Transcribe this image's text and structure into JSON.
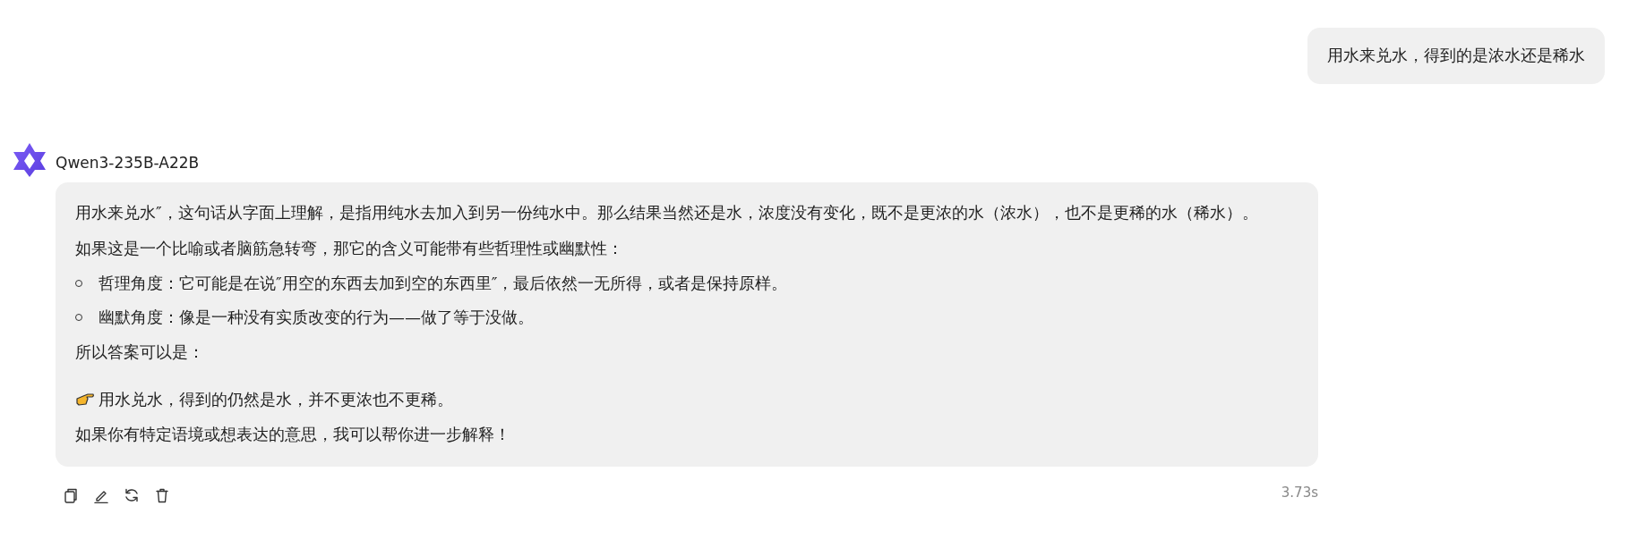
{
  "user_message": {
    "text": "用水来兑水，得到的是浓水还是稀水"
  },
  "assistant": {
    "model_name": "Qwen3-235B-A22B",
    "blocks": [
      {
        "kind": "paragraph",
        "text": "用水来兑水″，这句话从字面上理解，是指用纯水去加入到另一份纯水中。那么结果当然还是水，浓度没有变化，既不是更浓的水（浓水），也不是更稀的水（稀水）。"
      },
      {
        "kind": "paragraph",
        "text": "如果这是一个比喻或者脑筋急转弯，那它的含义可能带有些哲理性或幽默性："
      },
      {
        "kind": "bullets",
        "items": [
          "哲理角度：它可能是在说″用空的东西去加到空的东西里″，最后依然一无所得，或者是保持原样。",
          "幽默角度：像是一种没有实质改变的行为——做了等于没做。"
        ]
      },
      {
        "kind": "paragraph",
        "text": "所以答案可以是："
      },
      {
        "kind": "callout",
        "text": "用水兑水，得到的仍然是水，并不更浓也不更稀。"
      },
      {
        "kind": "paragraph",
        "text": "如果你有特定语境或想表达的意思，我可以帮你进一步解释！"
      }
    ],
    "elapsed": "3.73s"
  }
}
